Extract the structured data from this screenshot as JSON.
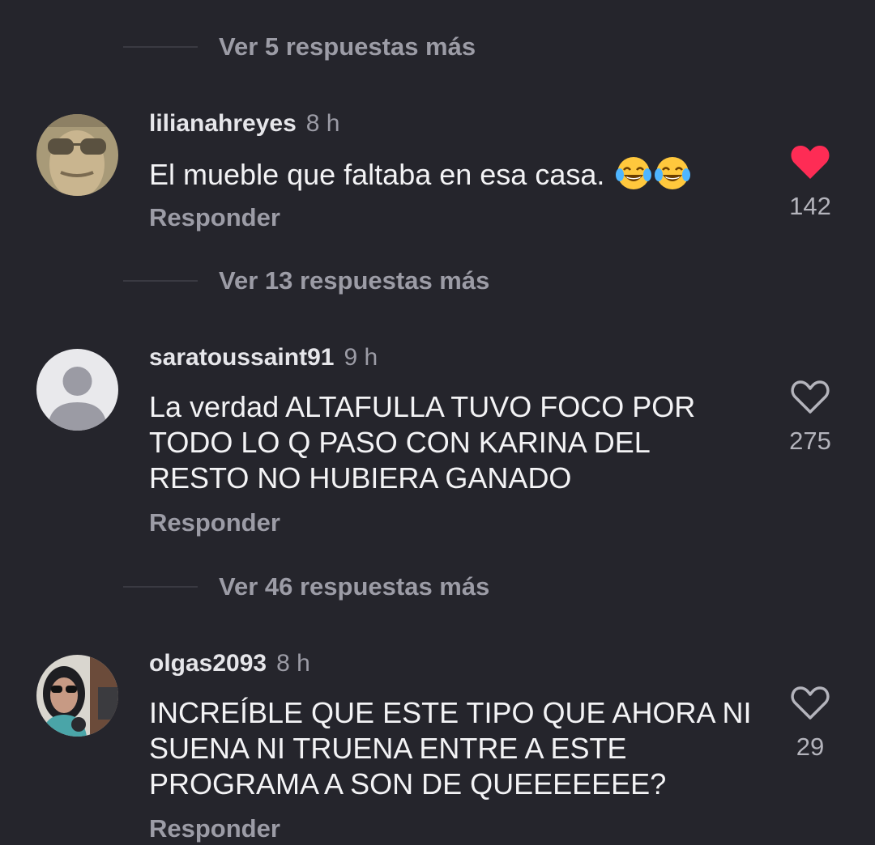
{
  "threads": [
    {
      "more_replies": "Ver 5 respuestas más"
    },
    {
      "username": "lilianahreyes",
      "time": "8 h",
      "text": "El mueble que faltaba en esa casa.",
      "emoji": [
        "face-with-tears-of-joy-icon",
        "face-with-tears-of-joy-icon"
      ],
      "reply_label": "Responder",
      "likes": "142",
      "liked": true,
      "more_replies": "Ver 13 respuestas más"
    },
    {
      "username": "saratoussaint91",
      "time": "9 h",
      "text": "La verdad ALTAFULLA TUVO FOCO POR TODO LO Q PASO CON KARINA DEL RESTO NO HUBIERA GANADO",
      "reply_label": "Responder",
      "likes": "275",
      "liked": false,
      "more_replies": "Ver 46 respuestas más"
    },
    {
      "username": "olgas2093",
      "time": "8 h",
      "text": "INCREÍBLE QUE ESTE TIPO QUE AHORA NI SUENA NI TRUENA ENTRE A ESTE PROGRAMA A SON DE QUEEEEEEE?",
      "reply_label": "Responder",
      "likes": "29",
      "liked": false
    }
  ],
  "colors": {
    "background": "#25252c",
    "like_active": "#fe2c55",
    "secondary_text": "#9c9ca6"
  }
}
